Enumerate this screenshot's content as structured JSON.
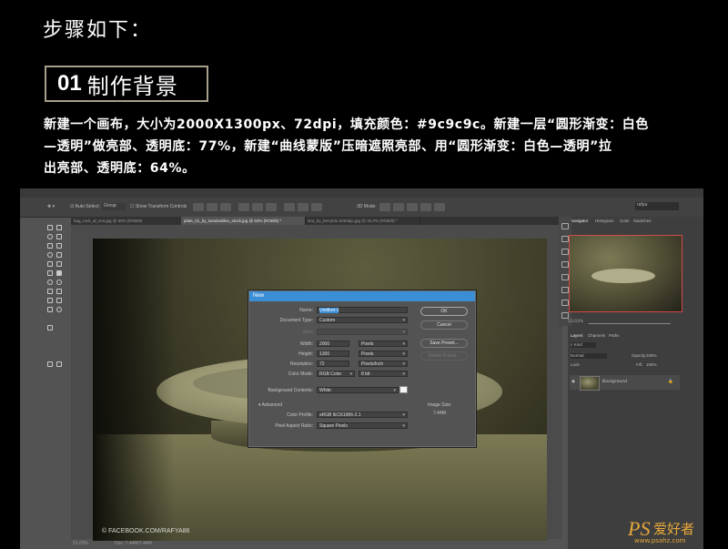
{
  "article": {
    "heading": "步骤如下：",
    "step_number": "01",
    "step_title": "制作背景",
    "desc_lines": [
      "新建一个画布，大小为2000X1300px、72dpi，填充颜色：#9c9c9c。新建一层“圆形渐变：白色",
      "—透明”做亮部、透明底：77%，新建“曲线蒙版”压暗遮照亮部、用“圆形渐变：白色—透明”拉",
      "出亮部、透明底：64%。"
    ]
  },
  "ps": {
    "options": {
      "auto_select": "Auto-Select:",
      "auto_select_value": "Group",
      "show_transform": "Show Transform Controls",
      "mode_3d": "3D Mode:",
      "search_value": "rafya"
    },
    "doc_tabs": [
      "bag_rock_al_sea.jpg @ 50% (RGB/8)",
      "plate_01_by_twodoubleu_stock.jpg @ 53% (RGB/8) *",
      "sea_by_berryblu-d3645jo.jpg @ 33.3% (RGB/8) *"
    ],
    "watermark": "© FACEBOOK.COM/RAFYA86",
    "status": {
      "zoom": "53.03%",
      "doc": "Doc: 7.44M/7.44M"
    },
    "dialog": {
      "title": "New",
      "name_label": "Name:",
      "name_value": "Untitled-1",
      "doc_type_label": "Document Type:",
      "doc_type_value": "Custom",
      "size_label": "Size:",
      "width_label": "Width:",
      "width_value": "2000",
      "width_unit": "Pixels",
      "height_label": "Height:",
      "height_value": "1300",
      "height_unit": "Pixels",
      "resolution_label": "Resolution:",
      "resolution_value": "72",
      "resolution_unit": "Pixels/Inch",
      "color_mode_label": "Color Mode:",
      "color_mode_value": "RGB Color",
      "bit_depth": "8 bit",
      "bg_contents_label": "Background Contents:",
      "bg_contents_value": "White",
      "advanced_label": "Advanced",
      "color_profile_label": "Color Profile:",
      "color_profile_value": "sRGB IEC61966-2.1",
      "pixel_aspect_label": "Pixel Aspect Ratio:",
      "pixel_aspect_value": "Square Pixels",
      "image_size_label": "Image Size:",
      "image_size_value": "7.44M",
      "ok": "OK",
      "cancel": "Cancel",
      "save_preset": "Save Preset...",
      "delete_preset": "Delete Preset..."
    },
    "panels": {
      "nav_tabs": [
        "Navigator",
        "Histogram",
        "Color",
        "Swatches"
      ],
      "zoom": "53.03%",
      "layer_tabs": [
        "Layers",
        "Channels",
        "Paths"
      ],
      "kind": "Kind",
      "blend": "Normal",
      "opacity_label": "Opacity:",
      "opacity_value": "100%",
      "lock_label": "Lock:",
      "fill_label": "Fill:",
      "fill_value": "100%",
      "layer_name": "Background"
    }
  },
  "site": {
    "logo": "PS",
    "logo_cn": "爱好者",
    "url": "www.psahz.com"
  }
}
